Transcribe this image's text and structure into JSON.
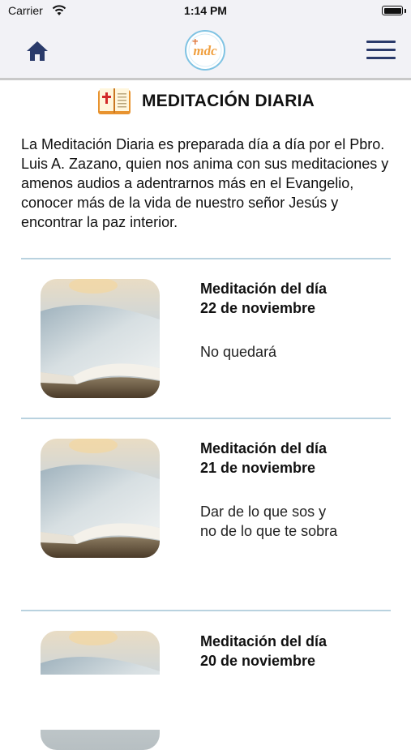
{
  "status_bar": {
    "carrier": "Carrier",
    "time": "1:14 PM"
  },
  "nav": {
    "logo_text": "mdc"
  },
  "header": {
    "title": "MEDITACIÓN DIARIA"
  },
  "intro": "La Meditación Diaria es preparada día a día por el Pbro. Luis A. Zazano, quien nos anima con sus meditaciones y amenos audios a adentrarnos más en el Evangelio, conocer más de la vida de nuestro señor Jesús y encontrar la paz interior.",
  "meditations": [
    {
      "title_line1": "Meditación del día",
      "title_line2": "22 de noviembre",
      "subtitle": "No quedará"
    },
    {
      "title_line1": "Meditación del día",
      "title_line2": "21 de noviembre",
      "subtitle": "Dar de lo que sos y no de lo que te sobra"
    },
    {
      "title_line1": "Meditación del día",
      "title_line2": "20 de noviembre",
      "subtitle": ""
    }
  ],
  "colors": {
    "nav_bg": "#f2f2f6",
    "divider": "#b9d2df",
    "menu": "#2a3a6a",
    "home": "#2a3a6a"
  }
}
